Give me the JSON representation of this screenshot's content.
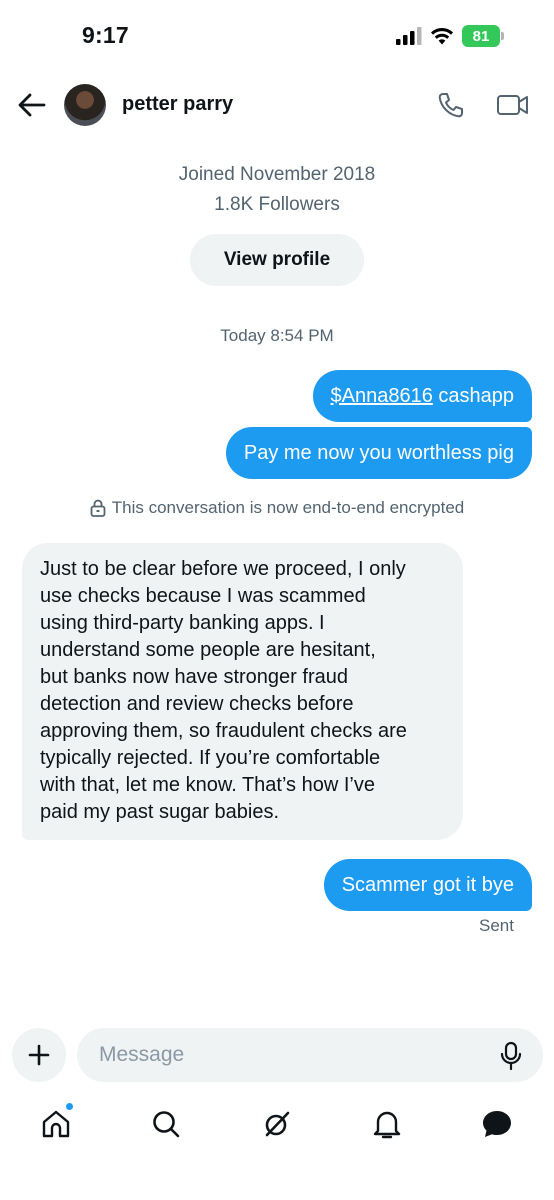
{
  "status_bar": {
    "time": "9:17",
    "battery": "81"
  },
  "header": {
    "name": "petter parry"
  },
  "profile": {
    "joined": "Joined November 2018",
    "followers": "1.8K Followers",
    "view_profile_label": "View profile"
  },
  "conversation": {
    "timestamp": "Today 8:54 PM",
    "outgoing_1": {
      "link": "$Anna8616",
      "text": " cashapp"
    },
    "outgoing_2": "Pay me now you worthless pig",
    "encrypted_notice": "This conversation is now end-to-end encrypted",
    "incoming_lines": [
      "Just to be clear before we proceed, I only",
      "use checks because I was scammed",
      "using third-party banking apps. I",
      "understand some people are hesitant,",
      "but banks now have stronger fraud",
      "detection and review checks before",
      "approving them, so fraudulent checks are",
      "typically rejected. If you’re comfortable",
      "with that, let me know. That’s how I’ve",
      "paid my past sugar babies."
    ],
    "outgoing_3": "Scammer got it bye",
    "sent_status": "Sent"
  },
  "composer": {
    "placeholder": "Message"
  },
  "tab_bar": {
    "icons": [
      "home-icon",
      "search-icon",
      "grok-icon",
      "bell-icon",
      "messages-icon"
    ]
  },
  "colors": {
    "accent": "#1d9bf0",
    "bubble_incoming": "#eff3f4",
    "muted_text": "#536471",
    "battery": "#34c759"
  }
}
